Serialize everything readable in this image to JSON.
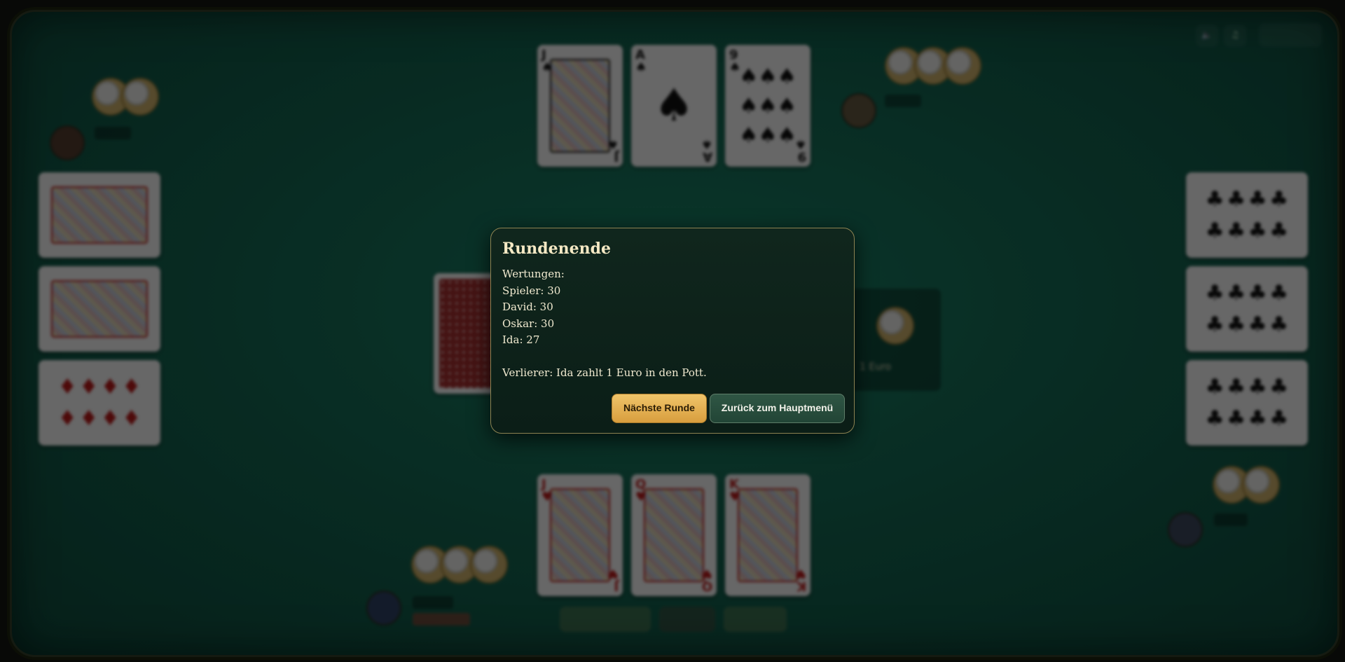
{
  "modal": {
    "title": "Rundenende",
    "scores_heading": "Wertungen:",
    "scores": [
      "Spieler: 30",
      "David: 30",
      "Oskar: 30",
      "Ida: 27"
    ],
    "loser_text": "Verlierer: Ida zahlt 1 Euro in den Pott.",
    "next_round_label": "Nächste Runde",
    "main_menu_label": "Zurück zum Hauptmenü"
  },
  "pot": {
    "label": "1 Euro"
  },
  "icons": {
    "sound": "speaker-icon",
    "music": "music-note-icon"
  },
  "colors": {
    "table_felt": "#0b3b2f",
    "modal_border": "#8d8352",
    "primary_button": "#e0ac4e",
    "secondary_button": "#2a4d3d"
  }
}
